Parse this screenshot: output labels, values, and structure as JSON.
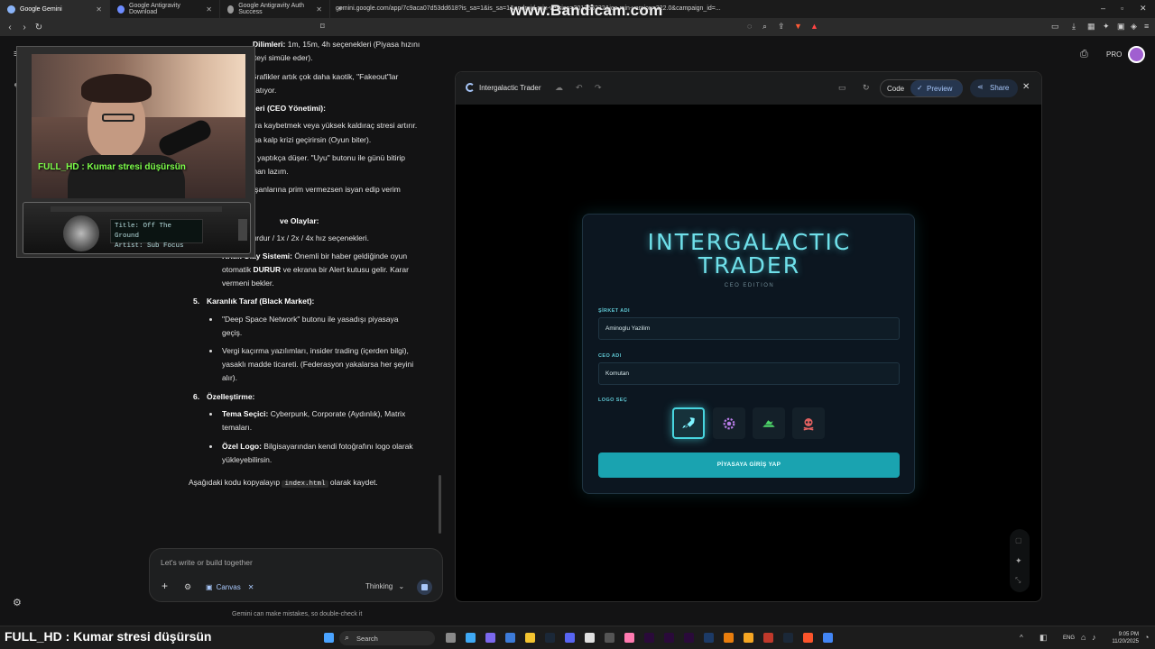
{
  "browser": {
    "tabs": [
      {
        "label": "Google Gemini",
        "active": true
      },
      {
        "label": "Google Antigravity Download",
        "active": false
      },
      {
        "label": "Google Antigravity Auth Success",
        "active": false
      }
    ],
    "url": "gemini.google.com/app/7c9aca07d53dd618?is_sa=1&is_sa=1&android-min-version=301356232&ios-min-version=322.0&campaign_id=...",
    "pro_label": "PRO",
    "badge_count": "3"
  },
  "watermark": "www.Bandicam.com",
  "chat": {
    "lines": [
      {
        "id": "l1",
        "html_parts": [
          {
            "b": "Dilimleri:"
          },
          {
            "t": " 1m, 15m, 4h seçenekleri (Piyasa hızını"
          }
        ]
      },
      {
        "id": "l2",
        "text": "iteyi simüle eder)."
      },
      {
        "id": "l3",
        "text": "Grafikler artık çok daha kaotik, \"Fakeout\"lar"
      },
      {
        "id": "l4",
        "text": ") atıyor."
      },
      {
        "id": "l5",
        "text": "tleri (CEO Yönetimi):"
      },
      {
        "id": "l6",
        "text": "ara kaybetmek veya yüksek kaldıraç stresi artırır."
      },
      {
        "id": "l7",
        "text": "rsa kalp krizi geçirirsin (Oyun biter)."
      },
      {
        "id": "l8",
        "text": "n yaptıkça düşer. \"Uyu\" butonu ile günü bitirip"
      },
      {
        "id": "l9",
        "text": "man lazım."
      },
      {
        "id": "l10",
        "text": "lışanlarına prim vermezsen isyan edip verim"
      },
      {
        "id": "l11",
        "text": "ve Olaylar:"
      }
    ],
    "item_speed": "Oyunu Durdur / 1x / 2x / 4x hız seçenekleri.",
    "crit_title": "Kritik Olay Sistemi:",
    "crit_text1": " Önemli bir haber geldiğinde oyun",
    "crit_text2a": "otomatik ",
    "crit_durur": "DURUR",
    "crit_text2b": " ve ekrana bir Alert kutusu gelir. Karar",
    "crit_text3": "vermeni bekler.",
    "sec5_num": "5.",
    "sec5_title": "Karanlık Taraf (Black Market):",
    "dsn1": "\"Deep Space Network\" butonu ile yasadışı piyasaya",
    "dsn2": "geçiş.",
    "tax1": "Vergi kaçırma yazılımları, insider trading (içerden bilgi),",
    "tax2": "yasaklı madde ticareti. (Federasyon yakalarsa her şeyini",
    "tax3": "alır).",
    "sec6_num": "6.",
    "sec6_title": "Özelleştirme:",
    "theme_title": "Tema Seçici:",
    "theme_text": " Cyberpunk, Corporate (Aydınlık), Matrix",
    "theme_text2": "temaları.",
    "logo_title": "Özel Logo:",
    "logo_text": " Bilgisayarından kendi fotoğrafını logo olarak",
    "logo_text2": "yükleyebilirsin.",
    "copy_a": "Aşağıdaki kodu kopyalayıp ",
    "copy_code": "index.html",
    "copy_b": " olarak kaydet."
  },
  "input": {
    "placeholder": "Let's write or build together",
    "canvas_chip": "Canvas",
    "mode": "Thinking"
  },
  "footnote": "Gemini can make mistakes, so double-check it",
  "canvas": {
    "title": "Intergalactic Trader",
    "code_label": "Code",
    "preview_label": "Preview",
    "share_label": "Share"
  },
  "game": {
    "title_line1": "INTERGALACTIC",
    "title_line2": "TRADER",
    "subtitle": "CEO EDITION",
    "company_label": "ŞİRKET ADI",
    "company_value": "Aminoglu Yazilim",
    "ceo_label": "CEO ADI",
    "ceo_value": "Komutan",
    "logo_label": "LOGO SEÇ",
    "logos": [
      "rocket-icon",
      "gear-flower-icon",
      "alien-ship-icon",
      "skull-icon"
    ],
    "selected_logo": 0,
    "start_button": "PİYASAYA GİRİŞ YAP",
    "accent": "#48d6e0"
  },
  "webcam": {
    "overlay": "FULL_HD : Kumar stresi düşürsün",
    "track_title": "Title: Off The Ground",
    "track_artist": "Artist: Sub Focus"
  },
  "taskbar": {
    "caption": "FULL_HD : Kumar stresi düşürsün",
    "search": "Search",
    "lang": "ENG",
    "time": "9:05 PM",
    "date": "11/20/2025"
  }
}
